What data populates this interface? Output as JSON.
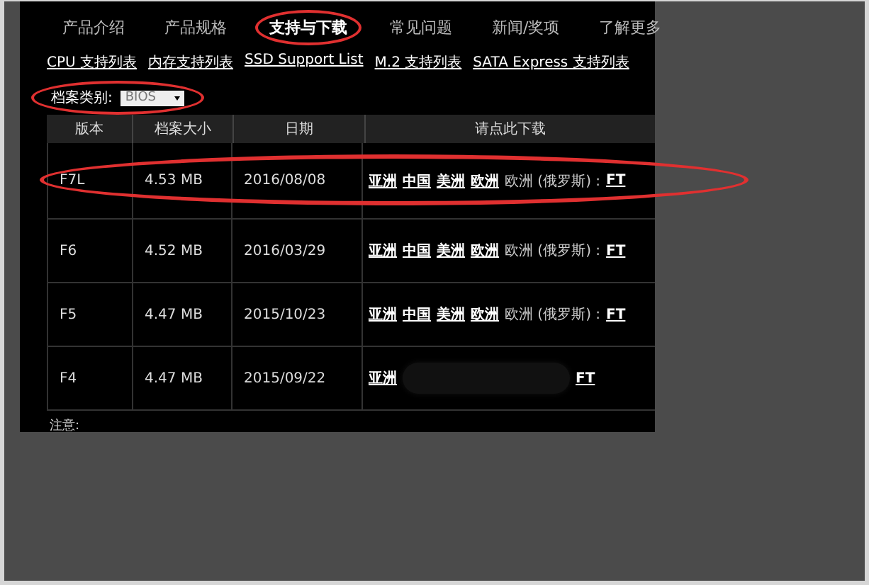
{
  "nav": [
    {
      "label": "产品介绍",
      "selected": false,
      "circled": false
    },
    {
      "label": "产品规格",
      "selected": false,
      "circled": false
    },
    {
      "label": "支持与下载",
      "selected": true,
      "circled": true
    },
    {
      "label": "常见问题",
      "selected": false,
      "circled": false
    },
    {
      "label": "新闻/奖项",
      "selected": false,
      "circled": false
    },
    {
      "label": "了解更多",
      "selected": false,
      "circled": false
    }
  ],
  "sub_links": [
    "CPU 支持列表",
    "内存支持列表",
    "SSD Support List",
    "M.2 支持列表",
    "SATA Express 支持列表"
  ],
  "file_type": {
    "label": "档案类别:",
    "value": "BIOS",
    "circled": true
  },
  "table": {
    "columns": [
      "版本",
      "档案大小",
      "日期",
      "请点此下载"
    ],
    "rows": [
      {
        "version": "F7L",
        "size": "4.53 MB",
        "date": "2016/08/08",
        "circled": true,
        "redacted": false,
        "links": [
          {
            "text": "亚洲",
            "kind": "link"
          },
          {
            "text": "中国",
            "kind": "link"
          },
          {
            "text": "美洲",
            "kind": "link"
          },
          {
            "text": "欧洲",
            "kind": "link"
          },
          {
            "text": "欧洲 (俄罗斯) :",
            "kind": "plain"
          },
          {
            "text": "FT",
            "kind": "link"
          }
        ]
      },
      {
        "version": "F6",
        "size": "4.52 MB",
        "date": "2016/03/29",
        "circled": false,
        "redacted": false,
        "links": [
          {
            "text": "亚洲",
            "kind": "link"
          },
          {
            "text": "中国",
            "kind": "link"
          },
          {
            "text": "美洲",
            "kind": "link"
          },
          {
            "text": "欧洲",
            "kind": "link"
          },
          {
            "text": "欧洲 (俄罗斯) :",
            "kind": "plain"
          },
          {
            "text": "FT",
            "kind": "link"
          }
        ]
      },
      {
        "version": "F5",
        "size": "4.47 MB",
        "date": "2015/10/23",
        "circled": false,
        "redacted": false,
        "links": [
          {
            "text": "亚洲",
            "kind": "link"
          },
          {
            "text": "中国",
            "kind": "link"
          },
          {
            "text": "美洲",
            "kind": "link"
          },
          {
            "text": "欧洲",
            "kind": "link"
          },
          {
            "text": "欧洲 (俄罗斯) :",
            "kind": "plain"
          },
          {
            "text": "FT",
            "kind": "link"
          }
        ]
      },
      {
        "version": "F4",
        "size": "4.47 MB",
        "date": "2015/09/22",
        "circled": false,
        "redacted": true,
        "links": [
          {
            "text": "亚洲",
            "kind": "link"
          },
          {
            "text": "FT",
            "kind": "link"
          }
        ]
      }
    ]
  },
  "note": "注意:"
}
